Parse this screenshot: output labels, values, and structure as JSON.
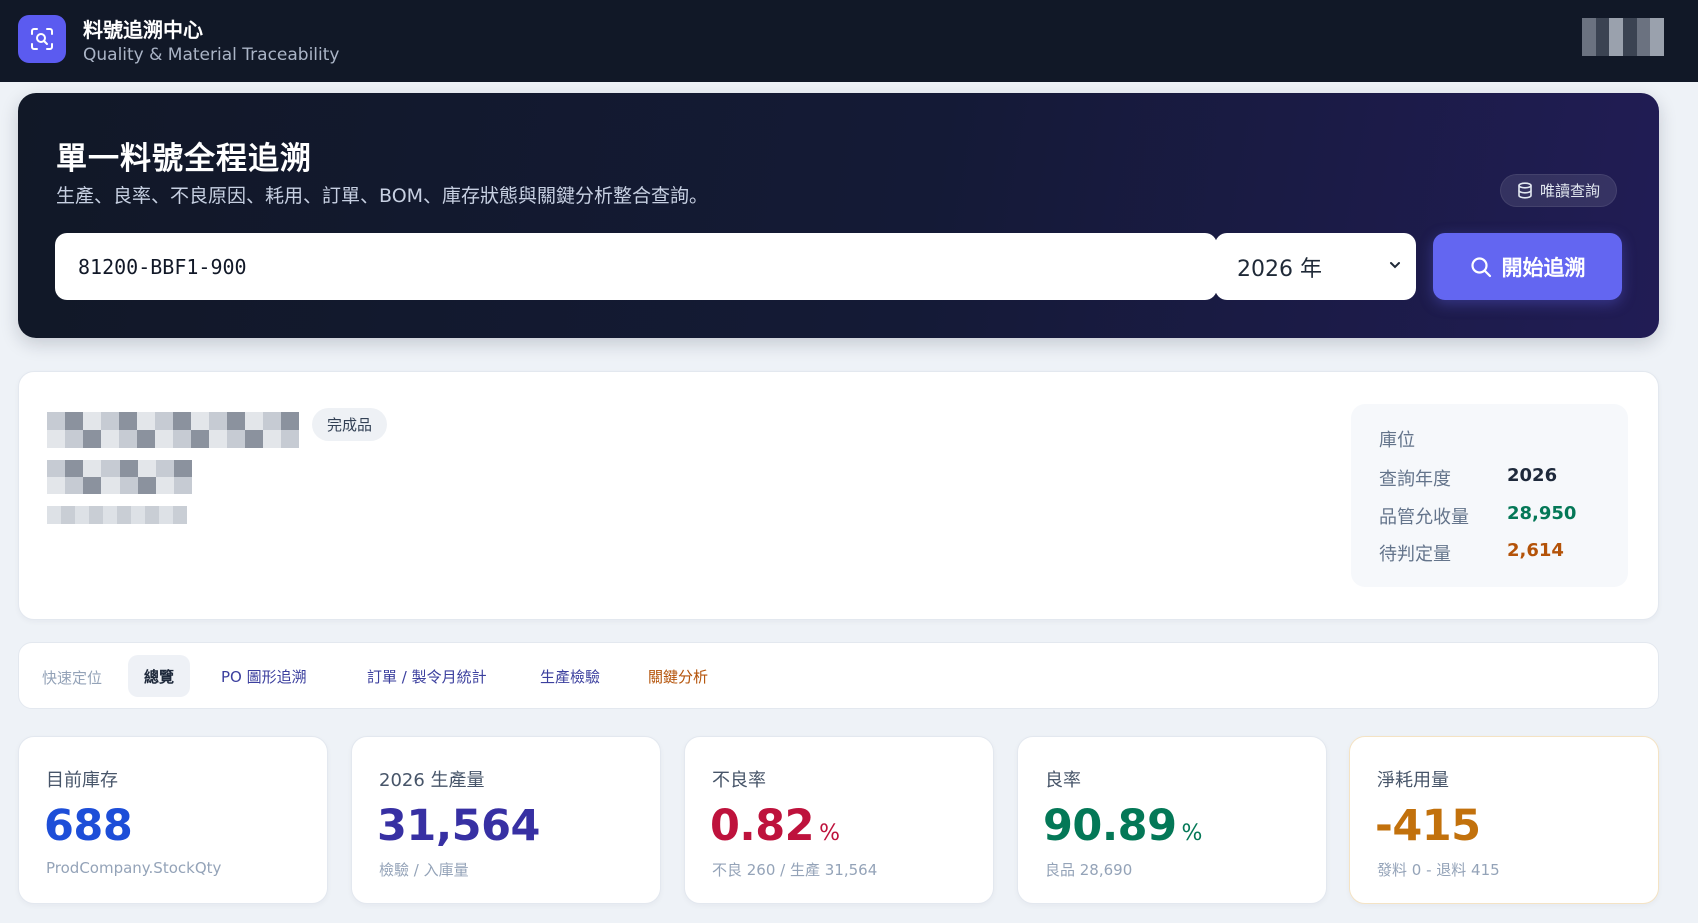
{
  "app": {
    "title": "料號追溯中心",
    "subtitle": "Quality & Material Traceability",
    "logo_icon": "search-scan-icon"
  },
  "hero": {
    "title": "單一料號全程追溯",
    "subtitle": "生產、良率、不良原因、耗用、訂單、BOM、庫存狀態與關鍵分析整合查詢。",
    "readonly_badge": "唯讀查詢",
    "readonly_icon": "database-icon",
    "part_number": "81200-BBF1-900",
    "year_selected": "2026 年",
    "trace_button": "開始追溯",
    "accent_color": "#6366f1"
  },
  "part": {
    "type_badge": "完成品",
    "location": {
      "title": "庫位",
      "rows": [
        {
          "label": "查詢年度",
          "value": "2026",
          "color": "#1e293b"
        },
        {
          "label": "品管允收量",
          "value": "28,950",
          "color": "#047857"
        },
        {
          "label": "待判定量",
          "value": "2,614",
          "color": "#b45309"
        }
      ]
    }
  },
  "quick_nav": {
    "label": "快速定位",
    "tabs": [
      {
        "label": "總覽",
        "active": true
      },
      {
        "label": "PO 圖形追溯",
        "active": false
      },
      {
        "label": "訂單 / 製令月統計",
        "active": false
      },
      {
        "label": "生產檢驗",
        "active": false
      },
      {
        "label": "關鍵分析",
        "active": false
      }
    ]
  },
  "kpis": [
    {
      "label": "目前庫存",
      "value": "688",
      "unit": "",
      "note": "ProdCompany.StockQty",
      "color": "#1d4ed8"
    },
    {
      "label": "2026 生產量",
      "value": "31,564",
      "unit": "",
      "note": "檢驗 / 入庫量",
      "color": "#3730a3"
    },
    {
      "label": "不良率",
      "value": "0.82",
      "unit": "%",
      "note": "不良 260 / 生產 31,564",
      "color": "#be123c"
    },
    {
      "label": "良率",
      "value": "90.89",
      "unit": "%",
      "note": "良品 28,690",
      "color": "#047857"
    },
    {
      "label": "淨耗用量",
      "value": "-415",
      "unit": "",
      "note": "發料 0 - 退料 415",
      "color": "#c2710c"
    }
  ]
}
